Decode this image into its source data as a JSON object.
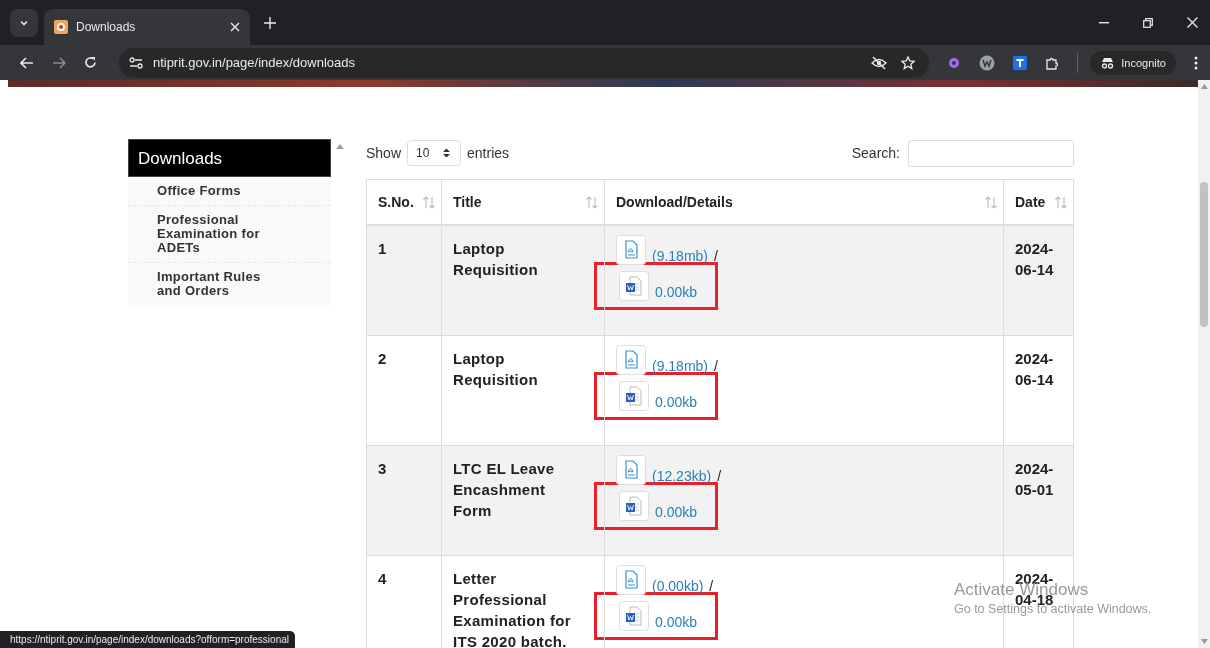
{
  "browser": {
    "tab_title": "Downloads",
    "url": "ntiprit.gov.in/page/index/downloads",
    "profile": "Incognito"
  },
  "sidebar": {
    "title": "Downloads",
    "items": [
      {
        "label": "Office Forms"
      },
      {
        "label": "Professional Examination for ADETs"
      },
      {
        "label": "Important Rules and Orders"
      }
    ]
  },
  "table_controls": {
    "show_label": "Show",
    "page_size": "10",
    "entries_label": "entries",
    "search_label": "Search:"
  },
  "table": {
    "columns": [
      "S.No.",
      "Title",
      "Download/Details",
      "Date"
    ],
    "rows": [
      {
        "sno": "1",
        "title": "Laptop Requisition",
        "pdf_size": "(9.18mb)",
        "separator": "/",
        "doc_size": "0.00kb",
        "date": "2024-06-14",
        "highlighted": true
      },
      {
        "sno": "2",
        "title": "Laptop Requisition",
        "pdf_size": "(9.18mb)",
        "separator": "/",
        "doc_size": "0.00kb",
        "date": "2024-06-14",
        "highlighted": true
      },
      {
        "sno": "3",
        "title": "LTC EL Leave Encashment Form",
        "pdf_size": "(12.23kb)",
        "separator": "/",
        "doc_size": "0.00kb",
        "date": "2024-05-01",
        "highlighted": true
      },
      {
        "sno": "4",
        "title": "Letter Professional Examination for ITS 2020 batch.",
        "pdf_size": "(0.00kb)",
        "separator": "/",
        "doc_size": "0.00kb",
        "date": "2024-04-18",
        "highlighted": true
      }
    ]
  },
  "status_url": "https://ntiprit.gov.in/page/index/downloads?ofform=professional",
  "os_watermark": {
    "title": "Activate Windows",
    "subtitle": "Go to Settings to activate Windows."
  }
}
